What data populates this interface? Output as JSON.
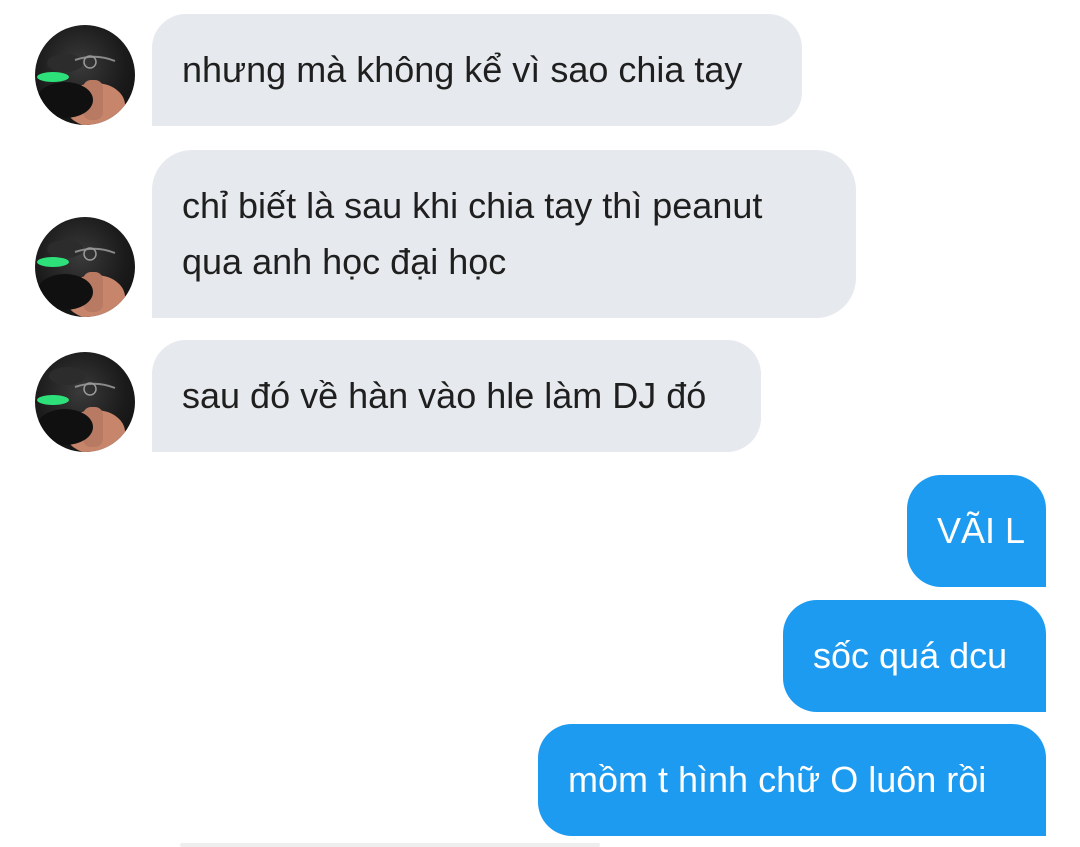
{
  "conversation": {
    "incoming": [
      {
        "lines": [
          "nhưng mà không kể vì sao chia tay"
        ]
      },
      {
        "lines": [
          "chỉ biết là sau khi chia tay thì peanut",
          "qua anh học đại học"
        ]
      },
      {
        "lines": [
          "sau đó về hàn vào hle làm DJ đó"
        ]
      }
    ],
    "outgoing": [
      {
        "lines": [
          "VÃI L"
        ]
      },
      {
        "lines": [
          "sốc quá dcu"
        ]
      },
      {
        "lines": [
          "mồm t hình chữ O luôn rồi"
        ]
      }
    ]
  },
  "colors": {
    "incoming_bubble": "#e6e9ed",
    "outgoing_bubble": "#1d9bf0",
    "incoming_text": "#1f1f1f",
    "outgoing_text": "#ffffff"
  },
  "icons": {
    "sender_avatar": "user-photo-avatar"
  }
}
